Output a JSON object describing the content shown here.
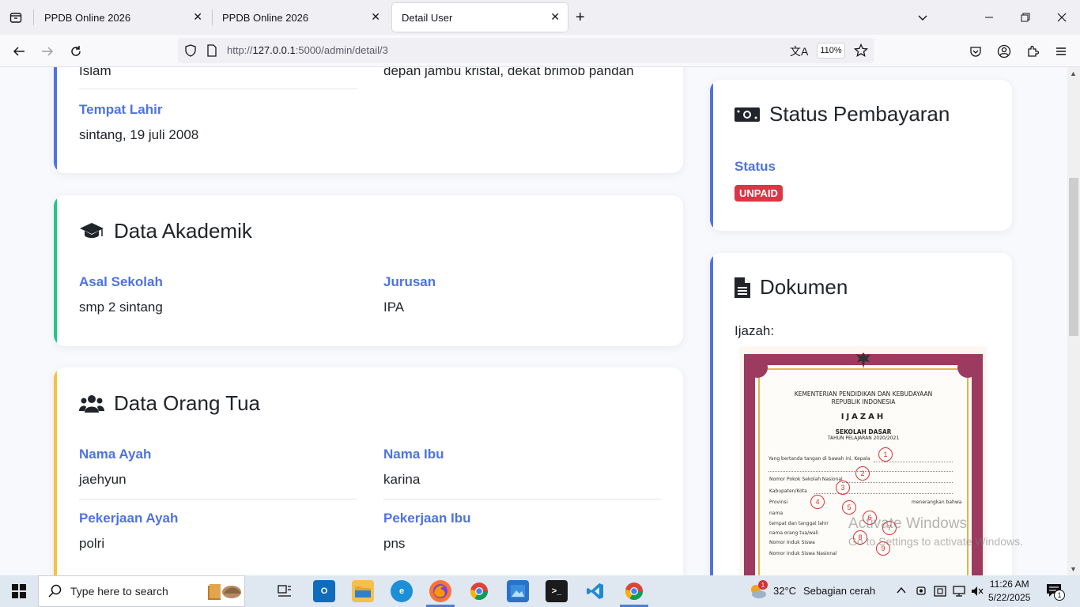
{
  "browser": {
    "tabs": [
      {
        "title": "PPDB Online 2026",
        "active": false
      },
      {
        "title": "PPDB Online 2026",
        "active": false
      },
      {
        "title": "Detail User",
        "active": true
      }
    ],
    "url_prefix": "http://",
    "url_host": "127.0.0.1",
    "url_path": ":5000/admin/detail/3",
    "zoom": "110%"
  },
  "data_pribadi": {
    "agama_value": "Islam",
    "alamat_value": "depan jambu kristal, dekat brimob pandan",
    "tempat_lahir_label": "Tempat Lahir",
    "tempat_lahir_value": "sintang, 19 juli 2008"
  },
  "data_akademik": {
    "title": "Data Akademik",
    "asal_sekolah_label": "Asal Sekolah",
    "asal_sekolah_value": "smp 2 sintang",
    "jurusan_label": "Jurusan",
    "jurusan_value": "IPA"
  },
  "data_orang_tua": {
    "title": "Data Orang Tua",
    "nama_ayah_label": "Nama Ayah",
    "nama_ayah_value": "jaehyun",
    "nama_ibu_label": "Nama Ibu",
    "nama_ibu_value": "karina",
    "pekerjaan_ayah_label": "Pekerjaan Ayah",
    "pekerjaan_ayah_value": "polri",
    "pekerjaan_ibu_label": "Pekerjaan Ibu",
    "pekerjaan_ibu_value": "pns"
  },
  "status_pembayaran": {
    "title": "Status Pembayaran",
    "status_label": "Status",
    "status_value": "UNPAID"
  },
  "dokumen": {
    "title": "Dokumen",
    "ijazah_label": "Ijazah:",
    "ijazah_image": {
      "line1": "KEMENTERIAN PENDIDIKAN DAN KEBUDAYAAN",
      "line2": "REPUBLIK INDONESIA",
      "heading": "IJAZAH",
      "school": "SEKOLAH DASAR",
      "year": "TAHUN PELAJARAN 2020/2021",
      "rows": [
        "Yang bertanda tangan di bawah ini, Kepala",
        "Nomor Pokok Sekolah Nasional",
        "Kabupaten/Kota",
        "Provinsi",
        "menerangkan bahwa",
        "nama",
        "tempat dan tanggal lahir",
        "nama orang tua/wali",
        "Nomor Induk Siswa",
        "Nomor Induk Siswa Nasional"
      ],
      "numbers": [
        "1",
        "2",
        "3",
        "4",
        "5",
        "6",
        "7",
        "8",
        "9"
      ]
    }
  },
  "watermark": {
    "line1": "Activate Windows",
    "line2": "Go to Settings to activate Windows."
  },
  "taskbar": {
    "search_placeholder": "Type here to search",
    "weather_temp": "32°C",
    "weather_desc": "Sebagian cerah",
    "weather_badge": "1",
    "time": "11:26 AM",
    "date": "5/22/2025",
    "notification_count": "1"
  }
}
